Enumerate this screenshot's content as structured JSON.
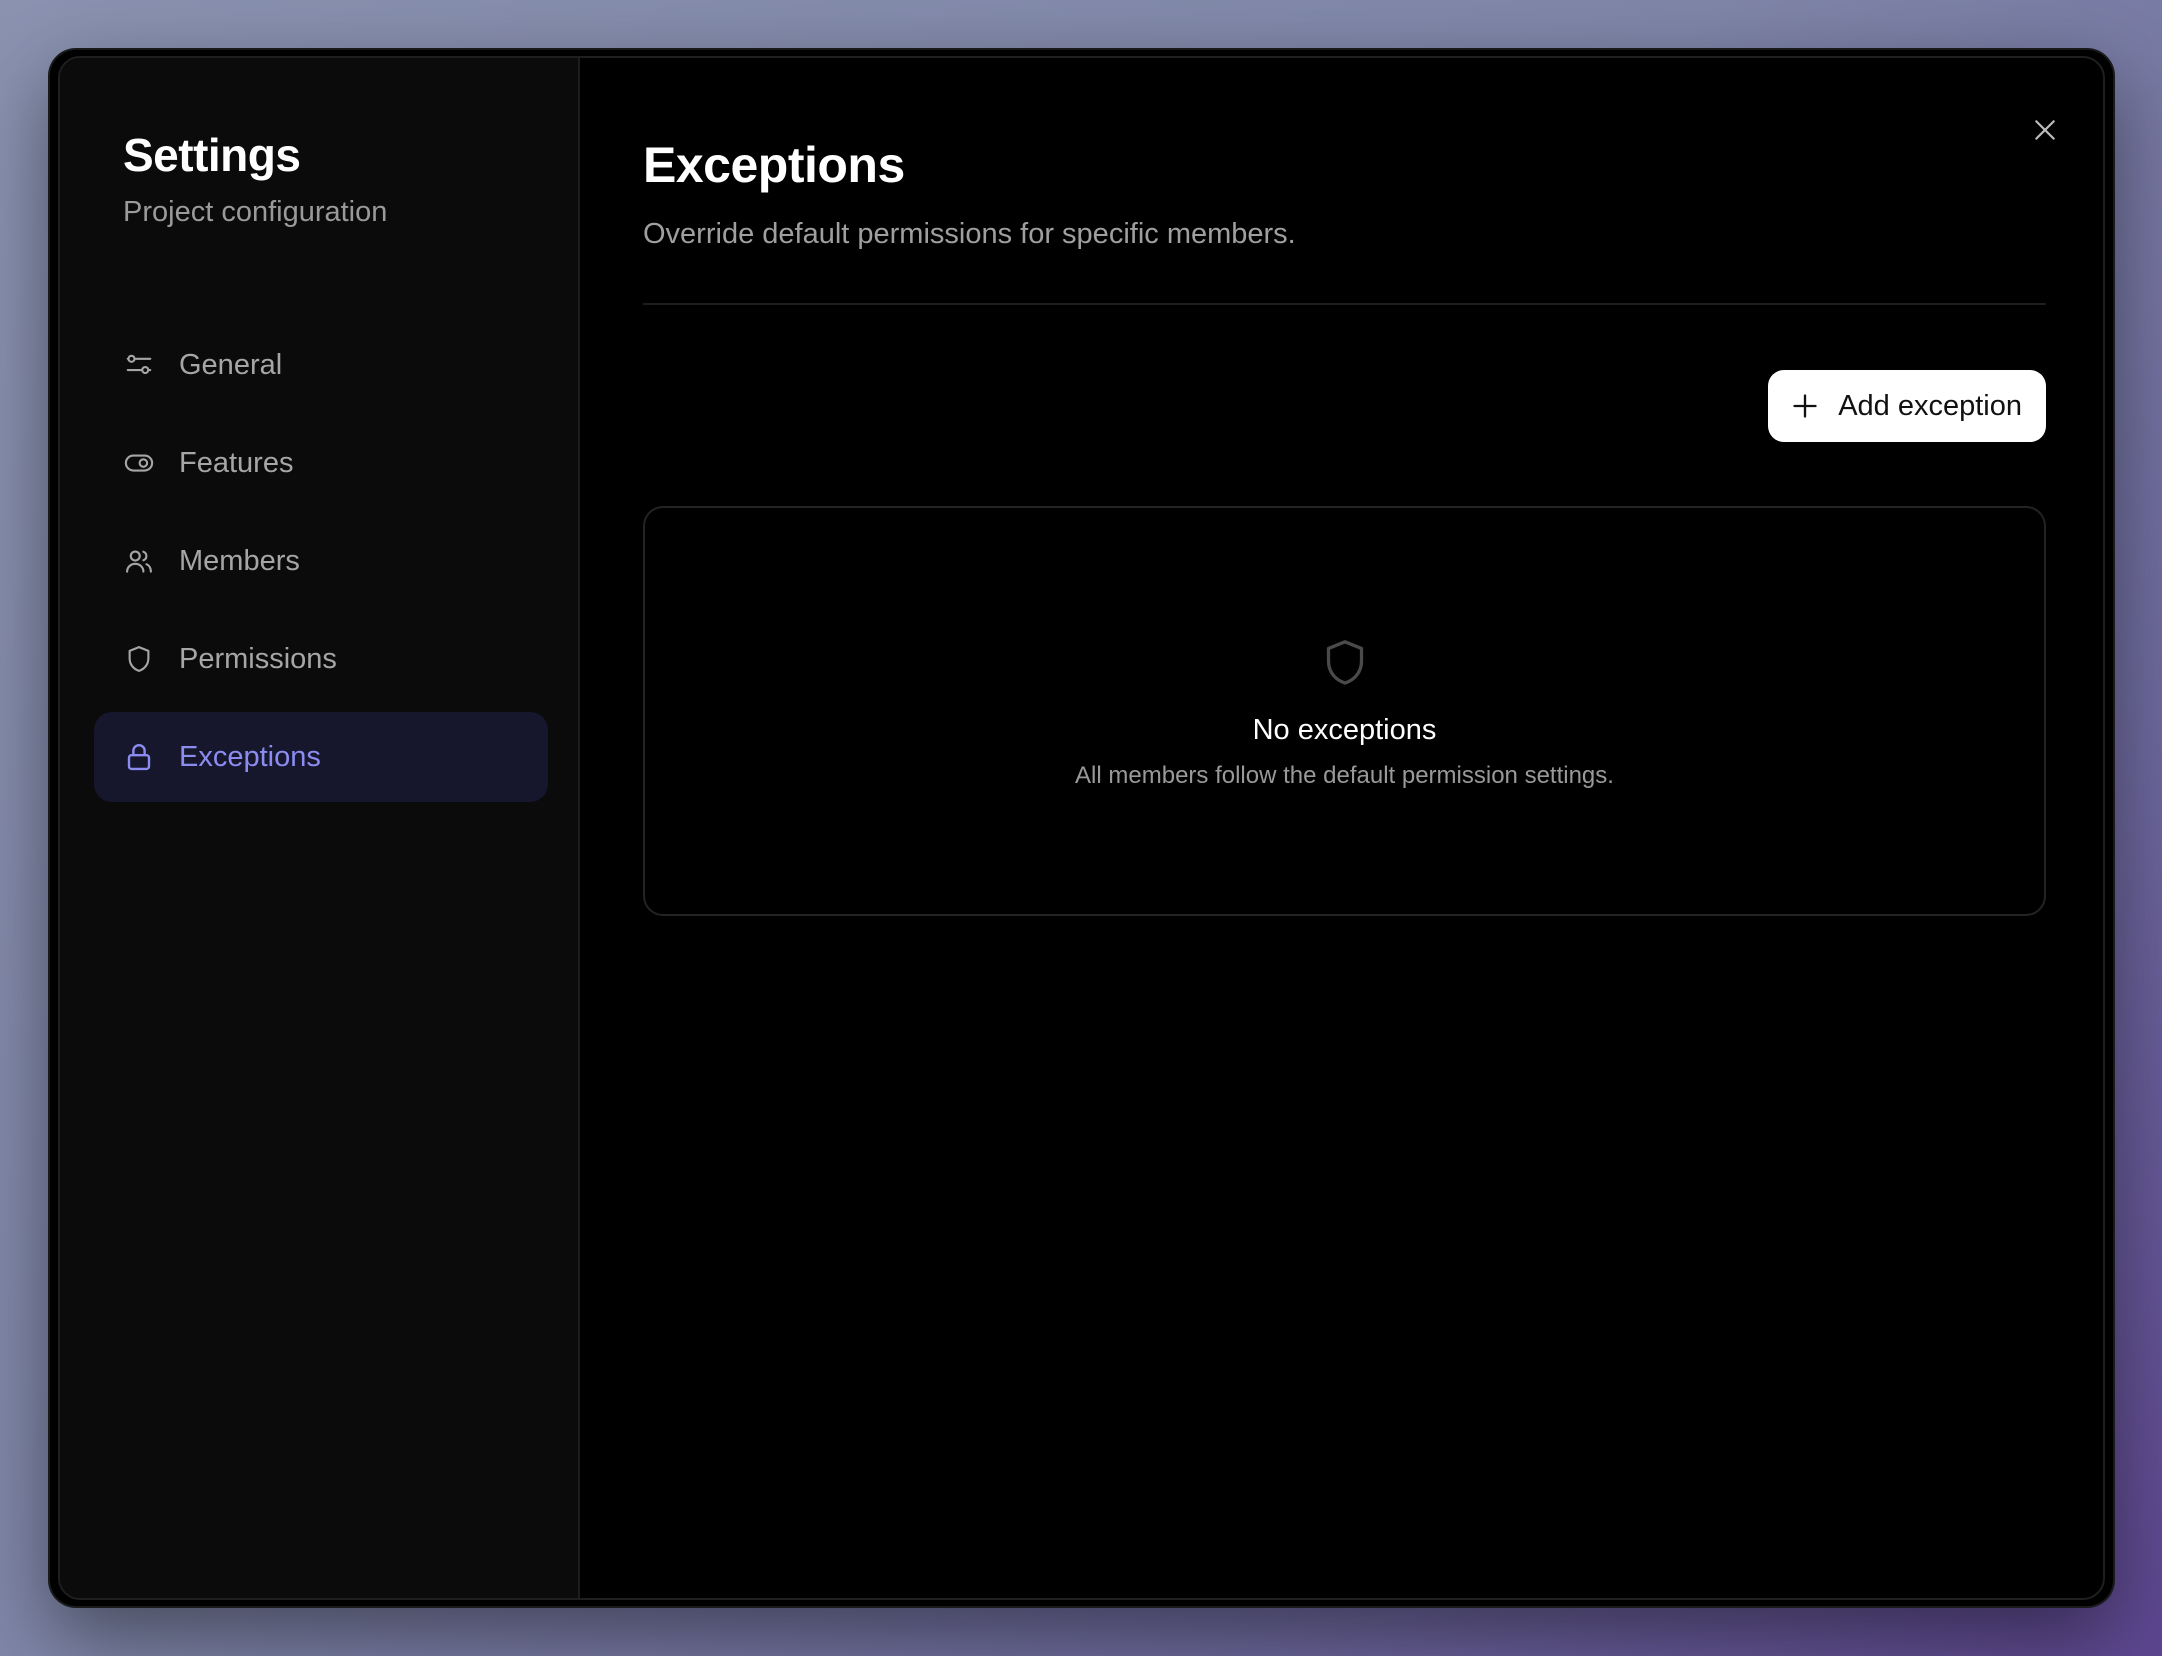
{
  "sidebar": {
    "title": "Settings",
    "subtitle": "Project configuration",
    "items": [
      {
        "label": "General",
        "icon": "sliders-icon",
        "active": false
      },
      {
        "label": "Features",
        "icon": "toggle-icon",
        "active": false
      },
      {
        "label": "Members",
        "icon": "users-icon",
        "active": false
      },
      {
        "label": "Permissions",
        "icon": "shield-icon",
        "active": false
      },
      {
        "label": "Exceptions",
        "icon": "lock-icon",
        "active": true
      }
    ]
  },
  "main": {
    "title": "Exceptions",
    "description": "Override default permissions for specific members.",
    "add_button_label": "Add exception",
    "empty_state": {
      "icon": "shield-icon",
      "title": "No exceptions",
      "description": "All members follow the default permission settings."
    }
  },
  "colors": {
    "accent": "#8c8cf0",
    "active_bg": "#16172d",
    "sidebar_bg": "#0b0b0b",
    "content_bg": "#000000"
  }
}
